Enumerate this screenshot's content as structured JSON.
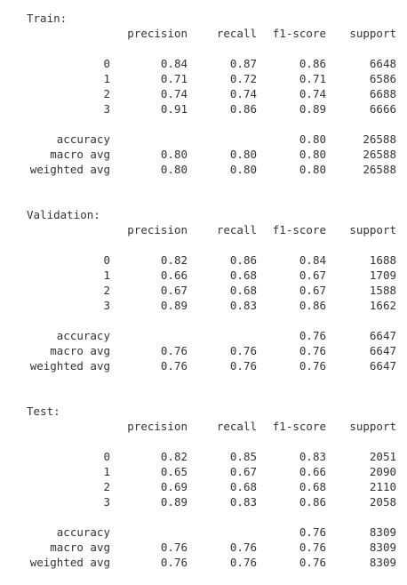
{
  "output_panel": {
    "sections": [
      {
        "title": "Train:",
        "headers": [
          "precision",
          "recall",
          "f1-score",
          "support"
        ],
        "class_rows": [
          {
            "label": "0",
            "precision": "0.84",
            "recall": "0.87",
            "f1": "0.86",
            "support": "6648"
          },
          {
            "label": "1",
            "precision": "0.71",
            "recall": "0.72",
            "f1": "0.71",
            "support": "6586"
          },
          {
            "label": "2",
            "precision": "0.74",
            "recall": "0.74",
            "f1": "0.74",
            "support": "6688"
          },
          {
            "label": "3",
            "precision": "0.91",
            "recall": "0.86",
            "f1": "0.89",
            "support": "6666"
          }
        ],
        "summary_rows": [
          {
            "label": "accuracy",
            "precision": "",
            "recall": "",
            "f1": "0.80",
            "support": "26588"
          },
          {
            "label": "macro avg",
            "precision": "0.80",
            "recall": "0.80",
            "f1": "0.80",
            "support": "26588"
          },
          {
            "label": "weighted avg",
            "precision": "0.80",
            "recall": "0.80",
            "f1": "0.80",
            "support": "26588"
          }
        ]
      },
      {
        "title": "Validation:",
        "headers": [
          "precision",
          "recall",
          "f1-score",
          "support"
        ],
        "class_rows": [
          {
            "label": "0",
            "precision": "0.82",
            "recall": "0.86",
            "f1": "0.84",
            "support": "1688"
          },
          {
            "label": "1",
            "precision": "0.66",
            "recall": "0.68",
            "f1": "0.67",
            "support": "1709"
          },
          {
            "label": "2",
            "precision": "0.67",
            "recall": "0.68",
            "f1": "0.67",
            "support": "1588"
          },
          {
            "label": "3",
            "precision": "0.89",
            "recall": "0.83",
            "f1": "0.86",
            "support": "1662"
          }
        ],
        "summary_rows": [
          {
            "label": "accuracy",
            "precision": "",
            "recall": "",
            "f1": "0.76",
            "support": "6647"
          },
          {
            "label": "macro avg",
            "precision": "0.76",
            "recall": "0.76",
            "f1": "0.76",
            "support": "6647"
          },
          {
            "label": "weighted avg",
            "precision": "0.76",
            "recall": "0.76",
            "f1": "0.76",
            "support": "6647"
          }
        ]
      },
      {
        "title": "Test:",
        "headers": [
          "precision",
          "recall",
          "f1-score",
          "support"
        ],
        "class_rows": [
          {
            "label": "0",
            "precision": "0.82",
            "recall": "0.85",
            "f1": "0.83",
            "support": "2051"
          },
          {
            "label": "1",
            "precision": "0.65",
            "recall": "0.67",
            "f1": "0.66",
            "support": "2090"
          },
          {
            "label": "2",
            "precision": "0.69",
            "recall": "0.68",
            "f1": "0.68",
            "support": "2110"
          },
          {
            "label": "3",
            "precision": "0.89",
            "recall": "0.83",
            "f1": "0.86",
            "support": "2058"
          }
        ],
        "summary_rows": [
          {
            "label": "accuracy",
            "precision": "",
            "recall": "",
            "f1": "0.76",
            "support": "8309"
          },
          {
            "label": "macro avg",
            "precision": "0.76",
            "recall": "0.76",
            "f1": "0.76",
            "support": "8309"
          },
          {
            "label": "weighted avg",
            "precision": "0.76",
            "recall": "0.76",
            "f1": "0.76",
            "support": "8309"
          }
        ]
      }
    ]
  }
}
